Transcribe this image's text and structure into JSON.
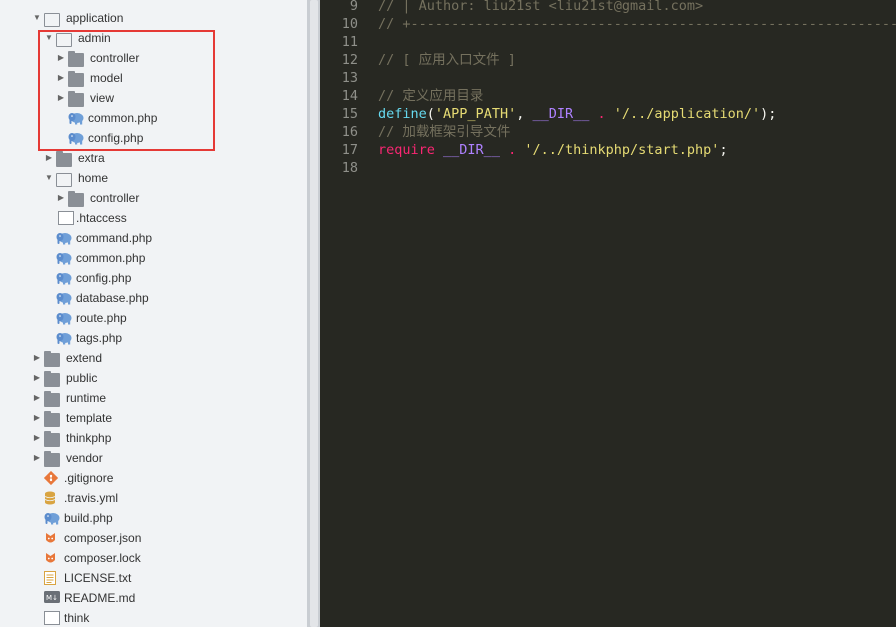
{
  "tree": {
    "items": [
      {
        "label": "application",
        "icon": "folder-open-icon",
        "toggle": "▼"
      },
      {
        "label": "admin",
        "icon": "folder-open-icon",
        "toggle": "▼"
      },
      {
        "label": "controller",
        "icon": "folder-icon",
        "toggle": "▶"
      },
      {
        "label": "model",
        "icon": "folder-icon",
        "toggle": "▶"
      },
      {
        "label": "view",
        "icon": "folder-icon",
        "toggle": "▶"
      },
      {
        "label": "common.php",
        "icon": "php-elephant-icon",
        "toggle": ""
      },
      {
        "label": "config.php",
        "icon": "php-elephant-icon",
        "toggle": ""
      },
      {
        "label": "extra",
        "icon": "folder-icon",
        "toggle": "▶"
      },
      {
        "label": "home",
        "icon": "folder-open-icon",
        "toggle": "▼"
      },
      {
        "label": "controller",
        "icon": "folder-icon",
        "toggle": "▶"
      },
      {
        "label": ".htaccess",
        "icon": "file-icon",
        "toggle": ""
      },
      {
        "label": "command.php",
        "icon": "php-elephant-icon",
        "toggle": ""
      },
      {
        "label": "common.php",
        "icon": "php-elephant-icon",
        "toggle": ""
      },
      {
        "label": "config.php",
        "icon": "php-elephant-icon",
        "toggle": ""
      },
      {
        "label": "database.php",
        "icon": "php-elephant-icon",
        "toggle": ""
      },
      {
        "label": "route.php",
        "icon": "php-elephant-icon",
        "toggle": ""
      },
      {
        "label": "tags.php",
        "icon": "php-elephant-icon",
        "toggle": ""
      },
      {
        "label": "extend",
        "icon": "folder-icon",
        "toggle": "▶"
      },
      {
        "label": "public",
        "icon": "folder-icon",
        "toggle": "▶"
      },
      {
        "label": "runtime",
        "icon": "folder-icon",
        "toggle": "▶"
      },
      {
        "label": "template",
        "icon": "folder-icon",
        "toggle": "▶"
      },
      {
        "label": "thinkphp",
        "icon": "folder-icon",
        "toggle": "▶"
      },
      {
        "label": "vendor",
        "icon": "folder-icon",
        "toggle": "▶"
      },
      {
        "label": ".gitignore",
        "icon": "git-icon",
        "toggle": ""
      },
      {
        "label": ".travis.yml",
        "icon": "database-icon",
        "toggle": ""
      },
      {
        "label": "build.php",
        "icon": "php-elephant-icon",
        "toggle": ""
      },
      {
        "label": "composer.json",
        "icon": "composer-icon",
        "toggle": ""
      },
      {
        "label": "composer.lock",
        "icon": "composer-icon",
        "toggle": ""
      },
      {
        "label": "LICENSE.txt",
        "icon": "text-file-icon",
        "toggle": ""
      },
      {
        "label": "README.md",
        "icon": "markdown-icon",
        "toggle": ""
      },
      {
        "label": "think",
        "icon": "file-icon",
        "toggle": ""
      }
    ]
  },
  "editor": {
    "lines": [
      {
        "num": "9",
        "segments": [
          {
            "c": "cm",
            "t": "// | Author: liu21st <liu21st@gmail.com>"
          }
        ]
      },
      {
        "num": "10",
        "segments": [
          {
            "c": "cm",
            "t": "// +----------------------------------------------------------------------"
          }
        ]
      },
      {
        "num": "11",
        "segments": []
      },
      {
        "num": "12",
        "segments": [
          {
            "c": "cm",
            "t": "// [ 应用入口文件 ]"
          }
        ]
      },
      {
        "num": "13",
        "segments": []
      },
      {
        "num": "14",
        "segments": [
          {
            "c": "cm",
            "t": "// 定义应用目录"
          }
        ]
      },
      {
        "num": "15",
        "segments": [
          {
            "c": "kw",
            "t": "define"
          },
          {
            "c": "",
            "t": "("
          },
          {
            "c": "st",
            "t": "'APP_PATH'"
          },
          {
            "c": "",
            "t": ", "
          },
          {
            "c": "mc",
            "t": "__DIR__"
          },
          {
            "c": "",
            "t": " "
          },
          {
            "c": "kr",
            "t": "."
          },
          {
            "c": "",
            "t": " "
          },
          {
            "c": "st",
            "t": "'/../application/'"
          },
          {
            "c": "",
            "t": ");"
          }
        ]
      },
      {
        "num": "16",
        "segments": [
          {
            "c": "cm",
            "t": "// 加载框架引导文件"
          }
        ]
      },
      {
        "num": "17",
        "segments": [
          {
            "c": "kr",
            "t": "require"
          },
          {
            "c": "",
            "t": " "
          },
          {
            "c": "mc",
            "t": "__DIR__"
          },
          {
            "c": "",
            "t": " "
          },
          {
            "c": "kr",
            "t": "."
          },
          {
            "c": "",
            "t": " "
          },
          {
            "c": "st",
            "t": "'/../thinkphp/start.php'"
          },
          {
            "c": "",
            "t": ";"
          }
        ]
      },
      {
        "num": "18",
        "segments": []
      }
    ]
  },
  "colors": {
    "highlight": "#e53935",
    "editor_bg": "#272822",
    "sidebar_bg": "#f1f3f5"
  }
}
